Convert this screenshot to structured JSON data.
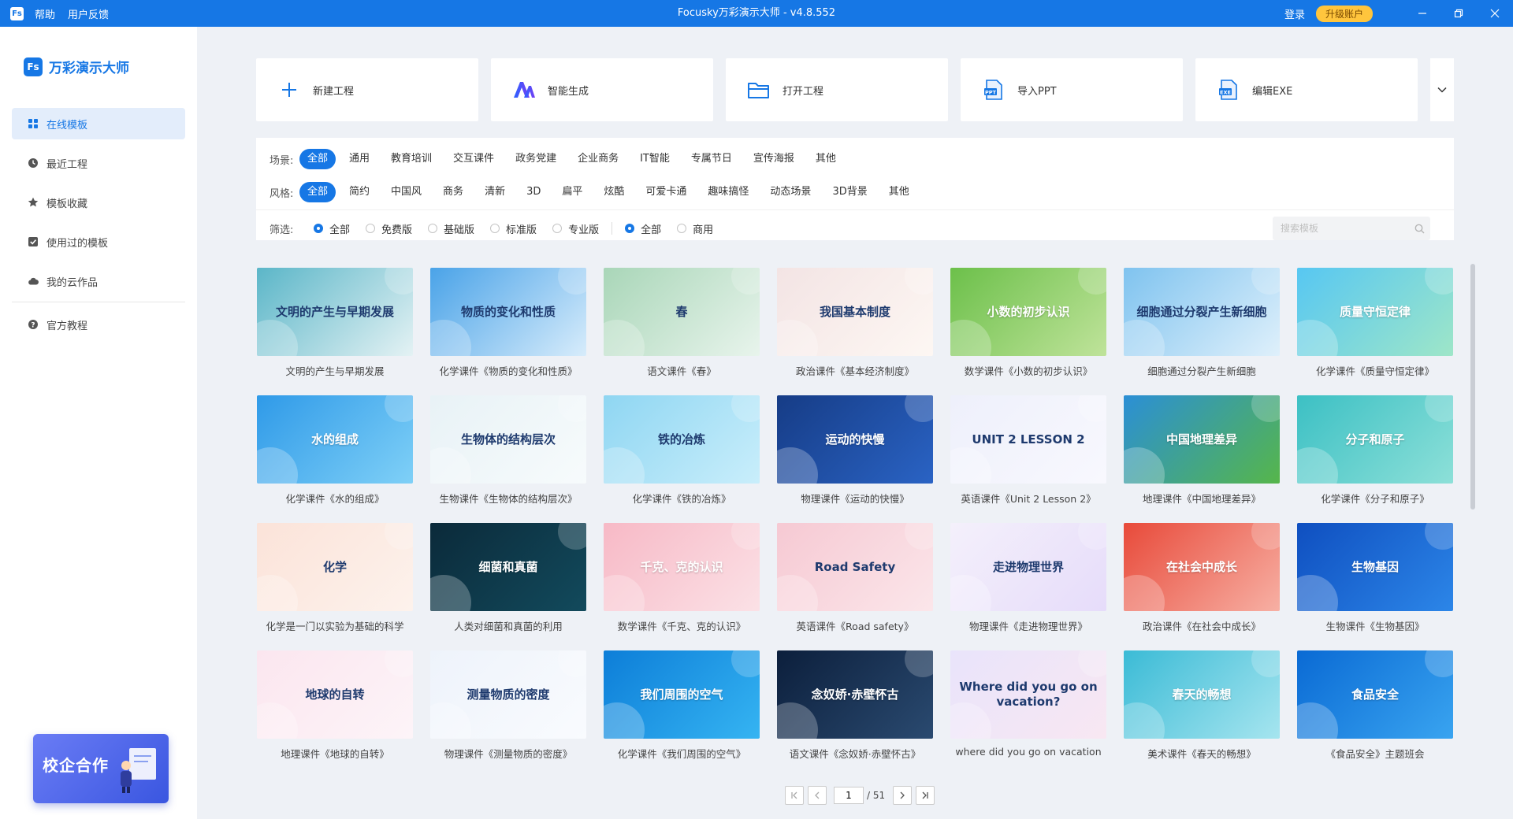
{
  "titlebar": {
    "logo": "Fs",
    "menu": [
      "帮助",
      "用户反馈"
    ],
    "title": "Focusky万彩演示大师 - v4.8.552",
    "login": "登录",
    "upgrade": "升级账户"
  },
  "sidebar": {
    "brand_mark": "Fs",
    "brand_name": "万彩演示大师",
    "items": [
      {
        "label": "在线模板",
        "icon": "grid-icon"
      },
      {
        "label": "最近工程",
        "icon": "clock-icon"
      },
      {
        "label": "模板收藏",
        "icon": "star-icon"
      },
      {
        "label": "使用过的模板",
        "icon": "check-icon"
      },
      {
        "label": "我的云作品",
        "icon": "cloud-icon"
      },
      {
        "label": "官方教程",
        "icon": "help-icon"
      }
    ],
    "promo": "校企合作"
  },
  "actions": [
    {
      "label": "新建工程",
      "icon": "plus-icon"
    },
    {
      "label": "智能生成",
      "icon": "ai-icon"
    },
    {
      "label": "打开工程",
      "icon": "folder-icon"
    },
    {
      "label": "导入PPT",
      "icon": "ppt-icon"
    },
    {
      "label": "编辑EXE",
      "icon": "exe-icon"
    }
  ],
  "filters": {
    "scene_label": "场景:",
    "scene": [
      "全部",
      "通用",
      "教育培训",
      "交互课件",
      "政务党建",
      "企业商务",
      "IT智能",
      "专属节日",
      "宣传海报",
      "其他"
    ],
    "style_label": "风格:",
    "style": [
      "全部",
      "简约",
      "中国风",
      "商务",
      "清新",
      "3D",
      "扁平",
      "炫酷",
      "可爱卡通",
      "趣味搞怪",
      "动态场景",
      "3D背景",
      "其他"
    ],
    "filter_label": "筛选:",
    "version": [
      "全部",
      "免费版",
      "基础版",
      "标准版",
      "专业版"
    ],
    "usage": [
      "全部",
      "商用"
    ],
    "search_placeholder": "搜索模板"
  },
  "templates": [
    {
      "caption": "文明的产生与早期发展",
      "thumb_title": "文明的产生与早期发展",
      "colors": [
        "#5bb6c8",
        "#e4f2f4"
      ],
      "dark": true
    },
    {
      "caption": "化学课件《物质的变化和性质》",
      "thumb_title": "物质的变化和性质",
      "colors": [
        "#4aa3e8",
        "#d7ecfb"
      ],
      "dark": true
    },
    {
      "caption": "语文课件《春》",
      "thumb_title": "春",
      "colors": [
        "#a9d6b8",
        "#e8f4ec"
      ],
      "dark": true
    },
    {
      "caption": "政治课件《基本经济制度》",
      "thumb_title": "我国基本制度",
      "colors": [
        "#f3e4e4",
        "#fdf7f3"
      ],
      "dark": true
    },
    {
      "caption": "数学课件《小数的初步认识》",
      "thumb_title": "小数的初步认识",
      "colors": [
        "#6cc04a",
        "#bfe39a"
      ],
      "dark": false
    },
    {
      "caption": "细胞通过分裂产生新细胞",
      "thumb_title": "细胞通过分裂产生新细胞",
      "colors": [
        "#7fc3ef",
        "#dff0fb"
      ],
      "dark": true
    },
    {
      "caption": "化学课件《质量守恒定律》",
      "thumb_title": "质量守恒定律",
      "colors": [
        "#57c7f2",
        "#9ee6c8"
      ],
      "dark": false
    },
    {
      "caption": "化学课件《水的组成》",
      "thumb_title": "水的组成",
      "colors": [
        "#2f9ae8",
        "#7fd0f7"
      ],
      "dark": false
    },
    {
      "caption": "生物课件《生物体的结构层次》",
      "thumb_title": "生物体的结构层次",
      "colors": [
        "#e8f2f6",
        "#f7fbfc"
      ],
      "dark": true
    },
    {
      "caption": "化学课件《铁的冶炼》",
      "thumb_title": "铁的冶炼",
      "colors": [
        "#8fd6f2",
        "#c9eefb"
      ],
      "dark": true
    },
    {
      "caption": "物理课件《运动的快慢》",
      "thumb_title": "运动的快慢",
      "colors": [
        "#163c86",
        "#2a63c4"
      ],
      "dark": false
    },
    {
      "caption": "英语课件《Unit 2 Lesson 2》",
      "thumb_title": "UNIT 2 LESSON 2",
      "colors": [
        "#eef0fb",
        "#f8f8fe"
      ],
      "dark": true
    },
    {
      "caption": "地理课件《中国地理差异》",
      "thumb_title": "中国地理差异",
      "colors": [
        "#2b8fd6",
        "#56b64a"
      ],
      "dark": false
    },
    {
      "caption": "化学课件《分子和原子》",
      "thumb_title": "分子和原子",
      "colors": [
        "#3cc0c4",
        "#8de0d8"
      ],
      "dark": false
    },
    {
      "caption": "化学是一门以实验为基础的科学",
      "thumb_title": "化学",
      "colors": [
        "#fbe3d9",
        "#fdf2ec"
      ],
      "dark": true
    },
    {
      "caption": "人类对细菌和真菌的利用",
      "thumb_title": "细菌和真菌",
      "colors": [
        "#0b2a3a",
        "#124a5c"
      ],
      "dark": false
    },
    {
      "caption": "数学课件《千克、克的认识》",
      "thumb_title": "千克、克的认识",
      "colors": [
        "#f7b9c6",
        "#fbe1e6"
      ],
      "dark": false
    },
    {
      "caption": "英语课件《Road safety》",
      "thumb_title": "Road Safety",
      "colors": [
        "#f6c9d3",
        "#fbe6ea"
      ],
      "dark": true
    },
    {
      "caption": "物理课件《走进物理世界》",
      "thumb_title": "走进物理世界",
      "colors": [
        "#f4f0fb",
        "#e6dcfa"
      ],
      "dark": true
    },
    {
      "caption": "政治课件《在社会中成长》",
      "thumb_title": "在社会中成长",
      "colors": [
        "#e84a3a",
        "#f7b0a4"
      ],
      "dark": false
    },
    {
      "caption": "生物课件《生物基因》",
      "thumb_title": "生物基因",
      "colors": [
        "#0f4fc0",
        "#2c86e8"
      ],
      "dark": false
    },
    {
      "caption": "地理课件《地球的自转》",
      "thumb_title": "地球的自转",
      "colors": [
        "#fbe6ef",
        "#fdf4f8"
      ],
      "dark": true
    },
    {
      "caption": "物理课件《测量物质的密度》",
      "thumb_title": "测量物质的密度",
      "colors": [
        "#eef3fb",
        "#f9fbfe"
      ],
      "dark": true
    },
    {
      "caption": "化学课件《我们周围的空气》",
      "thumb_title": "我们周围的空气",
      "colors": [
        "#0d7ed8",
        "#35b4f2"
      ],
      "dark": false
    },
    {
      "caption": "语文课件《念奴娇·赤壁怀古》",
      "thumb_title": "念奴娇·赤壁怀古",
      "colors": [
        "#0c1f3c",
        "#2a4a70"
      ],
      "dark": false
    },
    {
      "caption": "where did you go on vacation",
      "thumb_title": "Where did you go on vacation?",
      "colors": [
        "#e9e4fb",
        "#f8e7f2"
      ],
      "dark": true
    },
    {
      "caption": "美术课件《春天的畅想》",
      "thumb_title": "春天的畅想",
      "colors": [
        "#3bbbd6",
        "#a6e5ef"
      ],
      "dark": false
    },
    {
      "caption": "《食品安全》主题班会",
      "thumb_title": "食品安全",
      "colors": [
        "#0a6ad4",
        "#39a4f0"
      ],
      "dark": false
    }
  ],
  "pagination": {
    "current": "1",
    "total": "/ 51"
  }
}
